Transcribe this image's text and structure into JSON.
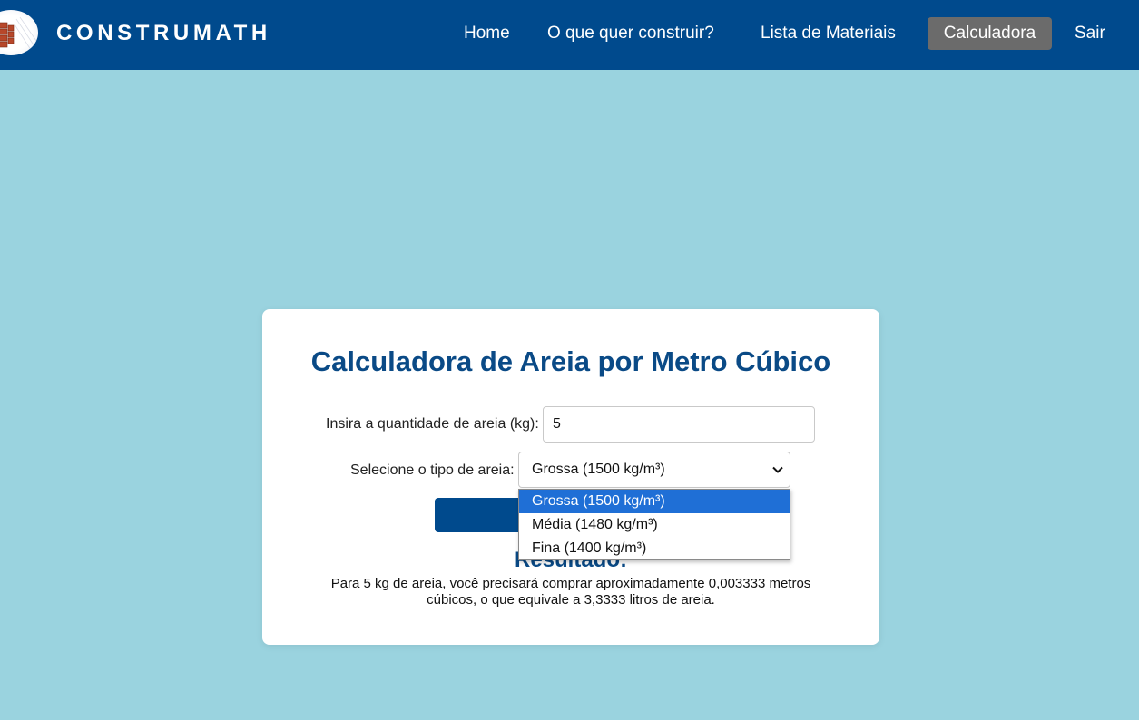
{
  "brand": {
    "name": "CONSTRUMATH",
    "logo": "brick-logo-icon"
  },
  "nav": {
    "items": [
      {
        "label": "Home",
        "active": false
      },
      {
        "label": "O que quer construir?",
        "active": false
      },
      {
        "label": "Lista de Materiais",
        "active": false
      },
      {
        "label": "Calculadora",
        "active": true
      },
      {
        "label": "Sair",
        "active": false
      }
    ]
  },
  "calculator": {
    "title": "Calculadora de Areia por Metro Cúbico",
    "quantity_label": "Insira a quantidade de areia (kg):",
    "quantity_value": "5",
    "type_label": "Selecione o tipo de areia:",
    "type_selected": "Grossa (1500 kg/m³)",
    "type_options": [
      "Grossa (1500 kg/m³)",
      "Média (1480 kg/m³)",
      "Fina (1400 kg/m³)"
    ],
    "result_title": "Resultado:",
    "result_text": "Para 5 kg de areia, você precisará comprar aproximadamente 0,003333 metros cúbicos, o que equivale a 3,3333 litros de areia."
  },
  "colors": {
    "page_background": "#9ad3df",
    "navbar": "#004a8d",
    "active_nav": "#6b6b6b",
    "title": "#0a4a86",
    "option_highlight": "#1f6fd6"
  }
}
